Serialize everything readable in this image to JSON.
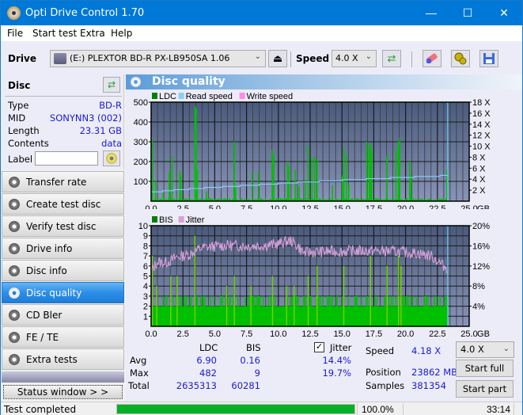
{
  "window": {
    "title": "Opti Drive Control 1.70",
    "minimize": "—",
    "maximize": "☐",
    "close": "✕"
  },
  "menu": [
    "File",
    "Start test",
    "Extra",
    "Help"
  ],
  "toolbar": {
    "drive_label": "Drive",
    "drive_value": "(E:)  PLEXTOR BD-R  PX-LB950SA 1.06",
    "eject_icon": "⏏",
    "speed_label": "Speed",
    "speed_value": "4.0 X",
    "refresh_icon": "⇄",
    "erase_icon": "eraser",
    "settings_icon": "gears",
    "save_icon": "floppy"
  },
  "disc": {
    "title": "Disc",
    "rows": [
      {
        "key": "Type",
        "value": "BD-R"
      },
      {
        "key": "MID",
        "value": "SONYNN3 (002)"
      },
      {
        "key": "Length",
        "value": "23.31 GB"
      },
      {
        "key": "Contents",
        "value": "data"
      }
    ],
    "label_key": "Label",
    "label_value": ""
  },
  "nav": [
    {
      "label": "Transfer rate",
      "active": false
    },
    {
      "label": "Create test disc",
      "active": false
    },
    {
      "label": "Verify test disc",
      "active": false
    },
    {
      "label": "Drive info",
      "active": false
    },
    {
      "label": "Disc info",
      "active": false
    },
    {
      "label": "Disc quality",
      "active": true
    },
    {
      "label": "CD Bler",
      "active": false
    },
    {
      "label": "FE / TE",
      "active": false
    },
    {
      "label": "Extra tests",
      "active": false
    }
  ],
  "status_window_label": "Status window > >",
  "panel_title": "Disc quality",
  "colors": {
    "ldc": "#00c000",
    "ldc_legend": "#008000",
    "read_speed": "#87cefa",
    "write_speed": "#ff88ee",
    "bis": "#00c000",
    "jitter": "#d8a0d8",
    "plot_bg_top": "#4a5a7c",
    "plot_bg_bottom": "#8894b8",
    "accent": "#0078d7",
    "value_text": "#1a1ad0",
    "progress": "#06b025"
  },
  "chart_data": [
    {
      "type": "bar",
      "title": "LDC / Read speed",
      "legend": [
        "LDC",
        "Read speed",
        "Write speed"
      ],
      "legend_position": "top-left",
      "xlabel": "GB",
      "xlim": [
        0,
        25
      ],
      "x_ticks": [
        "0.0",
        "2.5",
        "5.0",
        "7.5",
        "10.0",
        "12.5",
        "15.0",
        "17.5",
        "20.0",
        "22.5",
        "25.0"
      ],
      "ylim_left": [
        0,
        500
      ],
      "y_ticks_left": [
        "100",
        "200",
        "300",
        "400",
        "500"
      ],
      "ylim_right": [
        0,
        18
      ],
      "y_ticks_right": [
        "2 X",
        "4 X",
        "6 X",
        "8 X",
        "10 X",
        "12 X",
        "14 X",
        "16 X",
        "18 X"
      ],
      "grid": true,
      "data_end_gb": 23.31,
      "ldc_baseline": 12,
      "ldc_spikes": [
        [
          0.05,
          310
        ],
        [
          0.3,
          105
        ],
        [
          0.9,
          45
        ],
        [
          1.4,
          150
        ],
        [
          1.6,
          225
        ],
        [
          2.2,
          155
        ],
        [
          2.3,
          130
        ],
        [
          3.4,
          480
        ],
        [
          3.5,
          470
        ],
        [
          3.6,
          160
        ],
        [
          4.3,
          50
        ],
        [
          6.5,
          300
        ],
        [
          6.6,
          80
        ],
        [
          7.9,
          145
        ],
        [
          8.4,
          150
        ],
        [
          9.5,
          260
        ],
        [
          9.6,
          230
        ],
        [
          10.7,
          200
        ],
        [
          10.8,
          175
        ],
        [
          11.3,
          160
        ],
        [
          11.6,
          75
        ],
        [
          12.1,
          110
        ],
        [
          12.3,
          280
        ],
        [
          12.6,
          215
        ],
        [
          12.8,
          225
        ],
        [
          13.0,
          210
        ],
        [
          14.2,
          80
        ],
        [
          15.0,
          130
        ],
        [
          15.1,
          270
        ],
        [
          15.3,
          230
        ],
        [
          15.5,
          80
        ],
        [
          16.9,
          300
        ],
        [
          17.1,
          280
        ],
        [
          17.2,
          290
        ],
        [
          17.3,
          250
        ],
        [
          18.5,
          230
        ],
        [
          19.2,
          260
        ],
        [
          19.4,
          300
        ],
        [
          19.5,
          320
        ],
        [
          20.3,
          200
        ],
        [
          20.4,
          130
        ],
        [
          23.2,
          160
        ]
      ],
      "read_speed_steps": [
        [
          0,
          1.7
        ],
        [
          0.9,
          1.9
        ],
        [
          1.8,
          2.1
        ],
        [
          3.0,
          2.3
        ],
        [
          4.2,
          2.5
        ],
        [
          5.6,
          2.7
        ],
        [
          7.0,
          2.9
        ],
        [
          8.5,
          3.1
        ],
        [
          10.0,
          3.3
        ],
        [
          11.5,
          3.5
        ],
        [
          13.2,
          3.7
        ],
        [
          15.0,
          3.9
        ],
        [
          16.9,
          4.1
        ],
        [
          18.8,
          4.3
        ],
        [
          20.7,
          4.5
        ],
        [
          22.7,
          4.7
        ],
        [
          23.31,
          4.8
        ]
      ]
    },
    {
      "type": "bar",
      "title": "BIS / Jitter",
      "legend": [
        "BIS",
        "Jitter"
      ],
      "legend_position": "top-left",
      "xlabel": "GB",
      "xlim": [
        0,
        25
      ],
      "x_ticks": [
        "0.0",
        "2.5",
        "5.0",
        "7.5",
        "10.0",
        "12.5",
        "15.0",
        "17.5",
        "20.0",
        "22.5",
        "25.0"
      ],
      "ylim_left": [
        0,
        10
      ],
      "y_ticks_left": [
        "1",
        "2",
        "3",
        "4",
        "5",
        "6",
        "7",
        "8",
        "9",
        "10"
      ],
      "ylim_right": [
        0,
        20
      ],
      "y_ticks_right": [
        "4%",
        "8%",
        "12%",
        "16%",
        "20%"
      ],
      "grid": true,
      "data_end_gb": 23.31,
      "bis_baseline": 2,
      "bis_spikes": [
        [
          0.05,
          7
        ],
        [
          0.4,
          4
        ],
        [
          1.5,
          5
        ],
        [
          2.0,
          5
        ],
        [
          3.4,
          9
        ],
        [
          5.9,
          4
        ],
        [
          6.5,
          5
        ],
        [
          7.8,
          4
        ],
        [
          9.5,
          5
        ],
        [
          10.6,
          4
        ],
        [
          11.2,
          4
        ],
        [
          12.3,
          5
        ],
        [
          13.0,
          6
        ],
        [
          15.1,
          6
        ],
        [
          17.2,
          7
        ],
        [
          18.5,
          6
        ],
        [
          19.4,
          7
        ],
        [
          19.6,
          6
        ]
      ],
      "jitter_points": [
        [
          0,
          11.0
        ],
        [
          0.5,
          12.8
        ],
        [
          1.0,
          12.6
        ],
        [
          1.5,
          13.0
        ],
        [
          2.0,
          13.8
        ],
        [
          2.5,
          14.0
        ],
        [
          3.0,
          14.3
        ],
        [
          3.5,
          15.0
        ],
        [
          4.0,
          15.6
        ],
        [
          5.0,
          15.9
        ],
        [
          6.0,
          16.1
        ],
        [
          7.0,
          16.0
        ],
        [
          8.0,
          16.0
        ],
        [
          9.0,
          16.1
        ],
        [
          10.0,
          16.4
        ],
        [
          10.5,
          16.8
        ],
        [
          11.0,
          17.0
        ],
        [
          11.5,
          16.0
        ],
        [
          12.0,
          14.6
        ],
        [
          13.0,
          14.8
        ],
        [
          14.0,
          14.9
        ],
        [
          15.0,
          14.9
        ],
        [
          16.0,
          15.0
        ],
        [
          17.0,
          15.0
        ],
        [
          18.0,
          15.0
        ],
        [
          19.0,
          14.9
        ],
        [
          20.0,
          14.7
        ],
        [
          21.0,
          14.5
        ],
        [
          22.0,
          14.0
        ],
        [
          22.5,
          13.0
        ],
        [
          23.0,
          12.0
        ],
        [
          23.31,
          11.5
        ]
      ]
    }
  ],
  "stats": {
    "col_ldc": "LDC",
    "col_bis": "BIS",
    "col_jitter": "Jitter",
    "jitter_checked": true,
    "rows": [
      {
        "label": "Avg",
        "ldc": "6.90",
        "bis": "0.16",
        "jitter": "14.4%"
      },
      {
        "label": "Max",
        "ldc": "482",
        "bis": "9",
        "jitter": "19.7%"
      },
      {
        "label": "Total",
        "ldc": "2635313",
        "bis": "60281",
        "jitter": ""
      }
    ],
    "speed_label": "Speed",
    "speed_value": "4.18 X",
    "position_label": "Position",
    "position_value": "23862 MB",
    "samples_label": "Samples",
    "samples_value": "381354",
    "speed_select": "4.0 X",
    "start_full": "Start full",
    "start_part": "Start part"
  },
  "statusbar": {
    "text": "Test completed",
    "progress": 100.0,
    "progress_label": "100.0%",
    "time": "33:14"
  }
}
